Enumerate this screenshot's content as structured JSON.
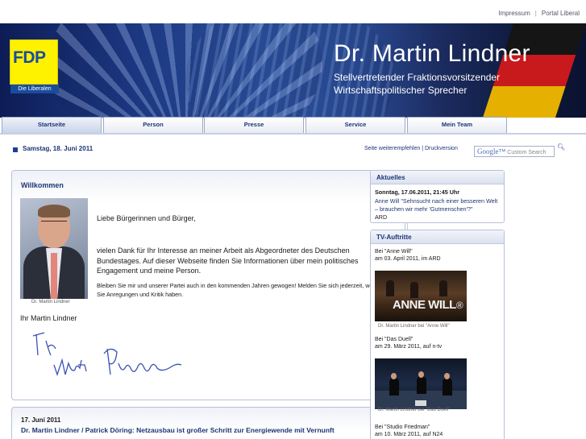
{
  "toplinks": {
    "impressum": "Impressum",
    "separator": "|",
    "portal": "Portal Liberal"
  },
  "banner": {
    "logo_text": "FDP",
    "logo_sub": "Die Liberalen",
    "name": "Dr. Martin Lindner",
    "role_line1": "Stellvertretender Fraktionsvorsitzender",
    "role_line2": "Wirtschaftspolitischer Sprecher"
  },
  "nav": {
    "tabs": [
      {
        "label": "Startseite"
      },
      {
        "label": "Person"
      },
      {
        "label": "Presse"
      },
      {
        "label": "Service"
      },
      {
        "label": "Mein Team"
      }
    ]
  },
  "datebar": {
    "date": "Samstag, 18. Juni 2011",
    "recommend": "Seite weiterempfehlen",
    "separator": "|",
    "print": "Druckversion",
    "search_brand": "Google™",
    "search_placeholder": "Custom Search"
  },
  "welcome": {
    "title": "Willkommen",
    "photo_caption": "Dr. Martin Lindner",
    "greeting": "Liebe Bürgerinnen und Bürger,",
    "paragraph1": "vielen Dank für Ihr Interesse an meiner Arbeit als Abgeordneter des Deutschen Bundestages. Auf dieser Webseite finden Sie Informationen über mein politisches Engagement und meine Person.",
    "paragraph2": "Bleiben Sie mir und unserer Partei auch in den kommenden Jahren gewogen! Melden Sie sich jederzeit, wenn Sie Anregungen und Kritik haben.",
    "closing": "Ihr Martin Lindner"
  },
  "news": {
    "date": "17. Juni 2011",
    "headline": "Dr. Martin Lindner / Patrick Döring: Netzausbau ist großer Schritt zur Energiewende mit Vernunft"
  },
  "aktuelles": {
    "title": "Aktuelles",
    "date": "Sonntag, 17.06.2011, 21:45 Uhr",
    "link": "Anne Will \"Sehnsucht nach einer besseren Welt – brauchen wir mehr 'Gutmenschen'?\"",
    "source": "ARD"
  },
  "tv": {
    "title": "TV-Auftritte",
    "items": [
      {
        "line1": "Bei \"Anne Will\"",
        "line2": "am 03. April 2011, im ARD",
        "caption": "Dr. Martin Lindner bei \"Anne Will\"",
        "thumb_text": "ANNE WILL",
        "thumb_mark": "®"
      },
      {
        "line1": "Bei \"Das Duell\"",
        "line2": "am 29. März 2011, auf n-tv",
        "caption": "Dr. Martin Lindner bei \"Das Duell\""
      },
      {
        "line1": "Bei \"Studio Friedman\"",
        "line2": "am 10. März 2011, auf N24"
      }
    ]
  },
  "colors": {
    "brand_blue": "#1e3575",
    "fdp_yellow": "#fff200",
    "fdp_blue": "#1a4c9c"
  }
}
